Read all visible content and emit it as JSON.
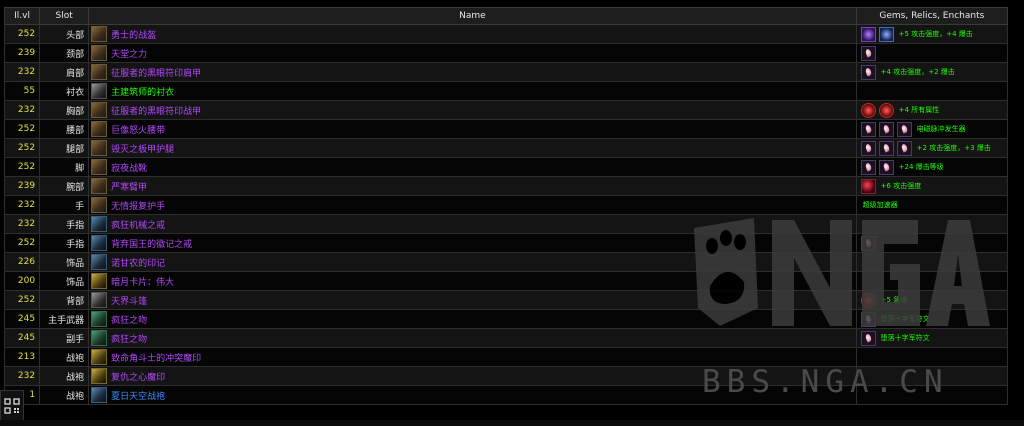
{
  "headers": {
    "ilvl": "Il.vl",
    "slot": "Slot",
    "name": "Name",
    "gems": "Gems, Relics, Enchants"
  },
  "rows": [
    {
      "ilvl": "252",
      "slot": "头部",
      "name": "勇士的战盔",
      "quality": "epic",
      "icon": "helm-icon",
      "gems": [
        "purple",
        "blue"
      ],
      "enchant": "+5 攻击强度，+4 爆击"
    },
    {
      "ilvl": "239",
      "slot": "颈部",
      "name": "天堂之力",
      "quality": "epic",
      "icon": "necklace-icon",
      "gems": [
        "pink"
      ],
      "enchant": ""
    },
    {
      "ilvl": "232",
      "slot": "肩部",
      "name": "征服者的黑眼符印肩甲",
      "quality": "epic",
      "icon": "shoulder-icon",
      "gems": [
        "pink"
      ],
      "enchant": "+4 攻击强度，+2 爆击"
    },
    {
      "ilvl": "55",
      "slot": "衬衣",
      "name": "主建筑师的衬衣",
      "quality": "uncommon",
      "icon": "shirt-icon",
      "gems": [],
      "enchant": ""
    },
    {
      "ilvl": "232",
      "slot": "胸部",
      "name": "征服者的黑眼符印战甲",
      "quality": "epic",
      "icon": "chest-icon",
      "gems": [
        "red",
        "red"
      ],
      "enchant": "+4 所有属性"
    },
    {
      "ilvl": "252",
      "slot": "腰部",
      "name": "巨像怒火腰带",
      "quality": "epic",
      "icon": "belt-icon",
      "gems": [
        "pink",
        "pink",
        "pink"
      ],
      "enchant": "电磁脉冲发生器"
    },
    {
      "ilvl": "252",
      "slot": "腿部",
      "name": "毁灭之板甲护腿",
      "quality": "epic",
      "icon": "legs-icon",
      "gems": [
        "pink",
        "pink",
        "pink"
      ],
      "enchant": "+2 攻击强度，+3 爆击"
    },
    {
      "ilvl": "252",
      "slot": "脚",
      "name": "寂夜战靴",
      "quality": "epic",
      "icon": "boots-icon",
      "gems": [
        "pink",
        "pink"
      ],
      "enchant": "+24 爆击等级"
    },
    {
      "ilvl": "239",
      "slot": "腕部",
      "name": "严寒臂甲",
      "quality": "epic",
      "icon": "wrist-icon",
      "gems": [
        "crimson"
      ],
      "enchant": "+6 攻击强度"
    },
    {
      "ilvl": "232",
      "slot": "手",
      "name": "无情报复护手",
      "quality": "epic",
      "icon": "gloves-icon",
      "gems": [],
      "enchant": "超级加速器"
    },
    {
      "ilvl": "232",
      "slot": "手指",
      "name": "疯狂机械之戒",
      "quality": "epic",
      "icon": "ring-icon",
      "gems": [],
      "enchant": ""
    },
    {
      "ilvl": "252",
      "slot": "手指",
      "name": "背弃国王的徽记之戒",
      "quality": "epic",
      "icon": "ring-icon",
      "gems": [
        "pink"
      ],
      "enchant": ""
    },
    {
      "ilvl": "226",
      "slot": "饰品",
      "name": "诺甘农的印记",
      "quality": "epic",
      "icon": "trinket-icon",
      "gems": [],
      "enchant": ""
    },
    {
      "ilvl": "200",
      "slot": "饰品",
      "name": "暗月卡片：伟大",
      "quality": "epic",
      "icon": "card-icon",
      "gems": [],
      "enchant": ""
    },
    {
      "ilvl": "252",
      "slot": "背部",
      "name": "天界斗篷",
      "quality": "epic",
      "icon": "cloak-icon",
      "gems": [
        "red"
      ],
      "enchant": "+5 急速"
    },
    {
      "ilvl": "245",
      "slot": "主手武器",
      "name": "疯狂之吻",
      "quality": "epic",
      "icon": "axe-icon",
      "gems": [
        "pink"
      ],
      "enchant": "堕落十字军符文"
    },
    {
      "ilvl": "245",
      "slot": "副手",
      "name": "疯狂之吻",
      "quality": "epic",
      "icon": "axe-icon",
      "gems": [
        "pink"
      ],
      "enchant": "堕落十字军符文"
    },
    {
      "ilvl": "213",
      "slot": "战袍",
      "name": "致命角斗士的冲突魔印",
      "quality": "epic",
      "icon": "sigil-icon",
      "gems": [],
      "enchant": ""
    },
    {
      "ilvl": "232",
      "slot": "战袍",
      "name": "复仇之心魔印",
      "quality": "epic",
      "icon": "sigil-icon",
      "gems": [],
      "enchant": ""
    },
    {
      "ilvl": "1",
      "slot": "战袍",
      "name": "夏日天空战袍",
      "quality": "rare",
      "icon": "tabard-icon",
      "gems": [],
      "enchant": ""
    }
  ],
  "watermark": {
    "text": "BBS.NGA.CN",
    "logo": "NGA"
  },
  "colors": {
    "epic": "#b048f8",
    "rare": "#3a8cff",
    "uncommon": "#1eff00",
    "ilvl": "#e0e040",
    "enchant": "#1eff00"
  }
}
